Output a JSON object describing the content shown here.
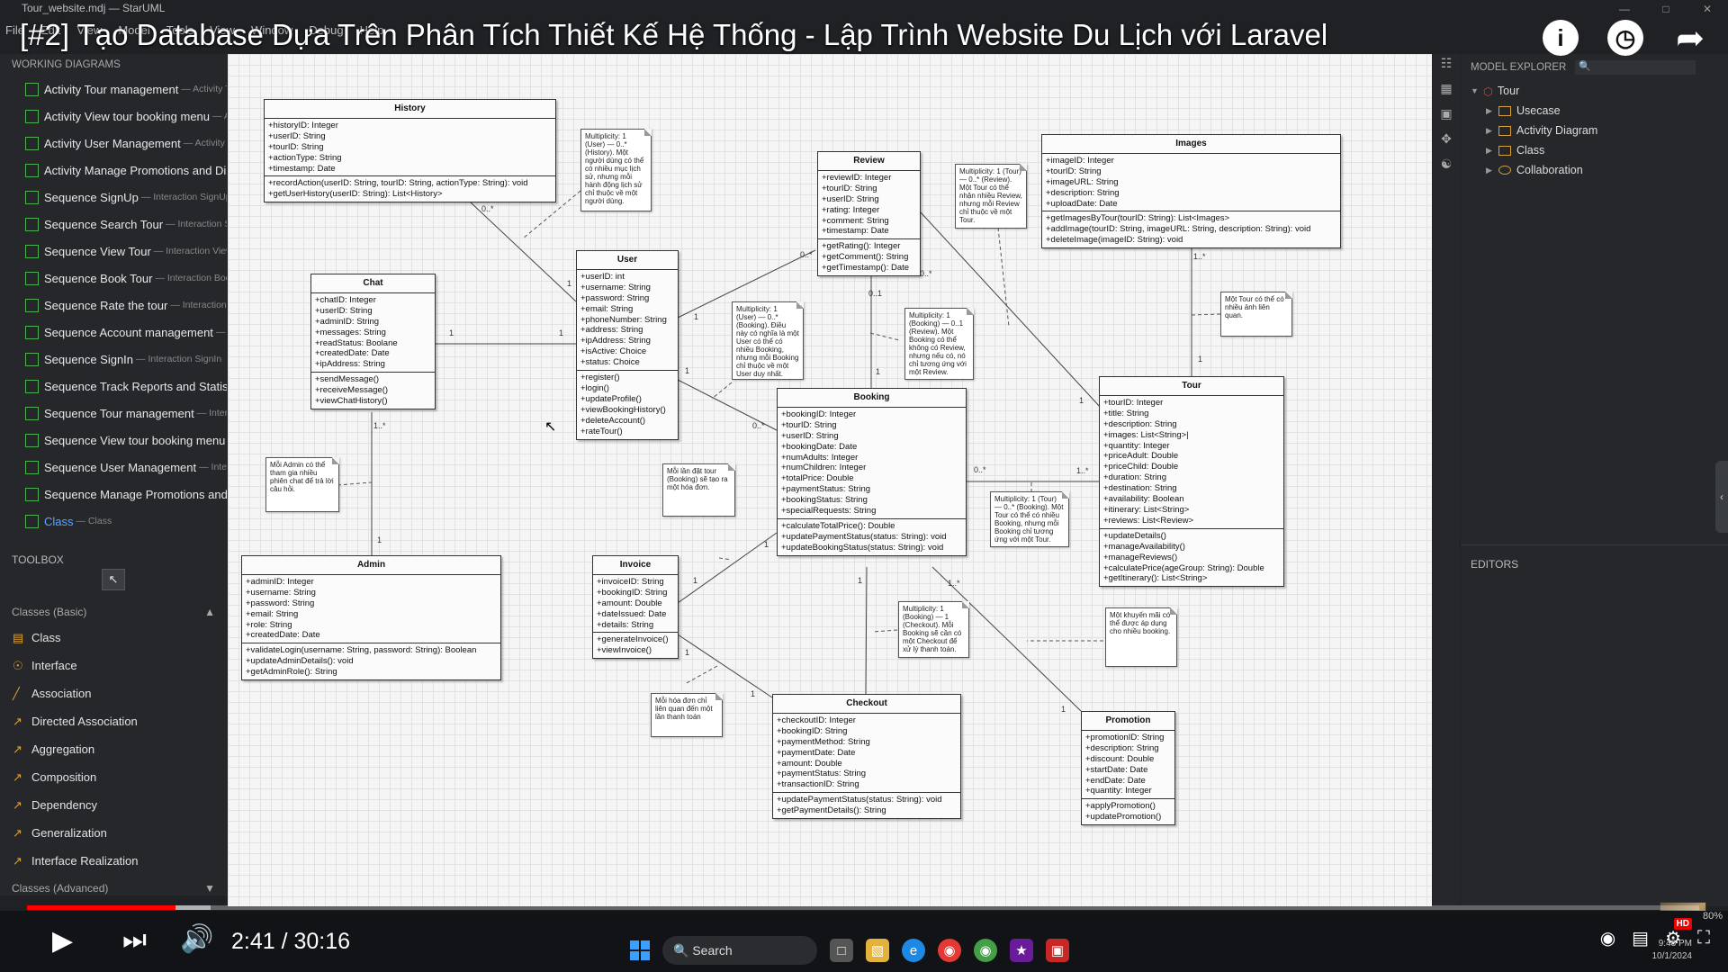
{
  "app": {
    "window_title": "Tour_website.mdj — StarUML",
    "menu": [
      "File",
      "Edit",
      "View",
      "Model",
      "Tools",
      "View",
      "Window",
      "Debug",
      "Help"
    ]
  },
  "video": {
    "title": "[#2] Tạo Database Dựa Trên Phân Tích Thiết Kế Hệ Thống - Lập Trình Website Du Lịch với Laravel",
    "time": "2:41 / 30:16",
    "progress": 0.089
  },
  "working": {
    "header": "WORKING DIAGRAMS",
    "items": [
      {
        "label": "Activity Tour management",
        "sub": "— Activity T"
      },
      {
        "label": "Activity View tour booking menu",
        "sub": "— Ac"
      },
      {
        "label": "Activity User Management",
        "sub": "— Activity U"
      },
      {
        "label": "Activity Manage Promotions and Disc",
        "sub": ""
      },
      {
        "label": "Sequence SignUp",
        "sub": "— Interaction SignUp"
      },
      {
        "label": "Sequence Search Tour",
        "sub": "— Interaction Se"
      },
      {
        "label": "Sequence View Tour",
        "sub": "— Interaction View"
      },
      {
        "label": "Sequence Book Tour",
        "sub": "— Interaction Book"
      },
      {
        "label": "Sequence Rate the tour",
        "sub": "— Interaction R"
      },
      {
        "label": "Sequence Account management",
        "sub": "— Int"
      },
      {
        "label": "Sequence SignIn",
        "sub": "— Interaction SignIn"
      },
      {
        "label": "Sequence Track Reports and Statistic",
        "sub": ""
      },
      {
        "label": "Sequence Tour management",
        "sub": "— Interac"
      },
      {
        "label": "Sequence View tour booking menu",
        "sub": "—"
      },
      {
        "label": "Sequence User Management",
        "sub": "— Interac"
      },
      {
        "label": "Sequence Manage Promotions and D",
        "sub": ""
      },
      {
        "label": "Class",
        "sub": "— Class"
      }
    ]
  },
  "toolbox": {
    "header": "TOOLBOX",
    "group_basic": "Classes (Basic)",
    "group_adv": "Classes (Advanced)",
    "tools": [
      "Class",
      "Interface",
      "Association",
      "Directed Association",
      "Aggregation",
      "Composition",
      "Dependency",
      "Generalization",
      "Interface Realization"
    ]
  },
  "explorer": {
    "header": "MODEL EXPLORER",
    "root": "Tour",
    "items": [
      "Usecase",
      "Activity Diagram",
      "Class",
      "Collaboration"
    ]
  },
  "editors": "EDITORS",
  "classes": {
    "history": {
      "name": "History",
      "attrs": [
        "+historyID: Integer",
        "+userID: String",
        "+tourID: String",
        "+actionType: String",
        "+timestamp: Date"
      ],
      "ops": [
        "+recordAction(userID: String, tourID: String, actionType: String): void",
        "+getUserHistory(userID: String): List<History>"
      ]
    },
    "chat": {
      "name": "Chat",
      "attrs": [
        "+chatID: Integer",
        "+userID: String",
        "+adminID: String",
        "+messages: String",
        "+readStatus: Boolane",
        "+createdDate: Date",
        "+ipAddress: String"
      ],
      "ops": [
        "+sendMessage()",
        "+receiveMessage()",
        "+viewChatHistory()"
      ]
    },
    "user": {
      "name": "User",
      "attrs": [
        "+userID: int",
        "+username: String",
        "+password: String",
        "+email: String",
        "+phoneNumber: String",
        "+address: String",
        "+ipAddress: String",
        "+isActive: Choice",
        "+status: Choice"
      ],
      "ops": [
        "+register()",
        "+login()",
        "+updateProfile()",
        "+viewBookingHistory()",
        "+deleteAccount()",
        "+rateTour()"
      ]
    },
    "review": {
      "name": "Review",
      "attrs": [
        "+reviewID: Integer",
        "+tourID: String",
        "+userID: String",
        "+rating: Integer",
        "+comment: String",
        "+timestamp: Date"
      ],
      "ops": [
        "+getRating(): Integer",
        "+getComment(): String",
        "+getTimestamp(): Date"
      ]
    },
    "images": {
      "name": "Images",
      "attrs": [
        "+imageID: Integer",
        "+tourID: String",
        "+imageURL: String",
        "+description: String",
        "+uploadDate: Date"
      ],
      "ops": [
        "+getImagesByTour(tourID: String): List<Images>",
        "+addImage(tourID: String, imageURL: String, description: String): void",
        "+deleteImage(imageID: String): void"
      ]
    },
    "booking": {
      "name": "Booking",
      "attrs": [
        "+bookingID: Integer",
        "+tourID: String",
        "+userID: String",
        "+bookingDate: Date",
        "+numAdults: Integer",
        "+numChildren: Integer",
        "+totalPrice: Double",
        "+paymentStatus: String",
        "+bookingStatus: String",
        "+specialRequests: String"
      ],
      "ops": [
        "+calculateTotalPrice(): Double",
        "+updatePaymentStatus(status: String): void",
        "+updateBookingStatus(status: String): void"
      ]
    },
    "tour": {
      "name": "Tour",
      "attrs": [
        "+tourID: Integer",
        "+title: String",
        "+description: String",
        "+images: List<String>|",
        "+quantity: Integer",
        "+priceAdult: Double",
        "+priceChild: Double",
        "+duration: String",
        "+destination: String",
        "+availability: Boolean",
        "+itinerary: List<String>",
        "+reviews: List<Review>"
      ],
      "ops": [
        "+updateDetails()",
        "+manageAvailability()",
        "+manageReviews()",
        "+calculatePrice(ageGroup: String): Double",
        "+getItinerary(): List<String>"
      ]
    },
    "admin": {
      "name": "Admin",
      "attrs": [
        "+adminID: Integer",
        "+username: String",
        "+password: String",
        "+email: String",
        "+role: String",
        "+createdDate: Date"
      ],
      "ops": [
        "+validateLogin(username: String, password: String): Boolean",
        "+updateAdminDetails(): void",
        "+getAdminRole(): String"
      ]
    },
    "invoice": {
      "name": "Invoice",
      "attrs": [
        "+invoiceID: String",
        "+bookingID: String",
        "+amount: Double",
        "+dateIssued: Date",
        "+details: String"
      ],
      "ops": [
        "+generateInvoice()",
        "+viewInvoice()"
      ]
    },
    "checkout": {
      "name": "Checkout",
      "attrs": [
        "+checkoutID: Integer",
        "+bookingID: String",
        "+paymentMethod: String",
        "+paymentDate: Date",
        "+amount: Double",
        "+paymentStatus: String",
        "+transactionID: String"
      ],
      "ops": [
        "+updatePaymentStatus(status: String): void",
        "+getPaymentDetails(): String"
      ]
    },
    "promotion": {
      "name": "Promotion",
      "attrs": [
        "+promotionID: String",
        "+description: String",
        "+discount: Double",
        "+startDate: Date",
        "+endDate: Date",
        "+quantity: Integer"
      ],
      "ops": [
        "+applyPromotion()",
        "+updatePromotion()"
      ]
    }
  },
  "notes": {
    "history": "Multiplicity: 1 (User) — 0..* (History). Một người dùng có thể có nhiều mục lịch sử, nhưng mỗi hành động lịch sử chỉ thuộc về một người dùng.",
    "review": "Multiplicity: 1 (Tour) — 0..* (Review). Một Tour có thể nhận nhiều Review, nhưng mỗi Review chỉ thuộc về một Tour.",
    "images": "Một Tour có thể có nhiều ảnh liên quan.",
    "userbooking": "Multiplicity: 1 (User) — 0..* (Booking). Điều này có nghĩa là một User có thể có nhiều Booking, nhưng mỗi Booking chỉ thuộc về một User duy nhất.",
    "bookingreview": "Multiplicity: 1 (Booking) — 0..1 (Review). Một Booking có thể không có Review, nhưng nếu có, nó chỉ tương ứng với một Review.",
    "admin": "Mỗi Admin có thể tham gia nhiều phiên chat để trả lời câu hỏi.",
    "invoicebooking": "Mỗi lần đặt tour (Booking) sẽ tạo ra một hóa đơn.",
    "tourbooking": "Multiplicity: 1 (Tour) — 0..* (Booking). Một Tour có thể có nhiều Booking, nhưng mỗi Booking chỉ tương ứng với một Tour.",
    "checkout": "Multiplicity: 1 (Booking) — 1 (Checkout). Mỗi Booking sẽ cần có một Checkout để xử lý thanh toán.",
    "promotion": "Một khuyến mãi có thể được áp dụng cho nhiều booking.",
    "invoice": "Mỗi hóa đơn chỉ liên quan đến một lần thanh toán"
  },
  "multiplicities": {
    "m1": "0..*",
    "m2": "1",
    "m3": "1",
    "m4": "1",
    "m5": "1..*",
    "m6": "1",
    "m7": "0..*",
    "m8": "0..*",
    "m9": "1",
    "m10": "0..*",
    "m11": "1",
    "m12": "0..1",
    "m13": "1",
    "m14": "1",
    "m15": "1..*",
    "m16": "1",
    "m17": "0..*",
    "m18": "1..*",
    "m19": "1",
    "m20": "1",
    "m21": "1",
    "m22": "1",
    "m23": "1",
    "m24": "1..*",
    "m25": "1"
  },
  "player": {
    "hd": "HD",
    "zoom": "80%",
    "clock": "9:48 PM",
    "date": "10/1/2024",
    "search": "Search"
  }
}
